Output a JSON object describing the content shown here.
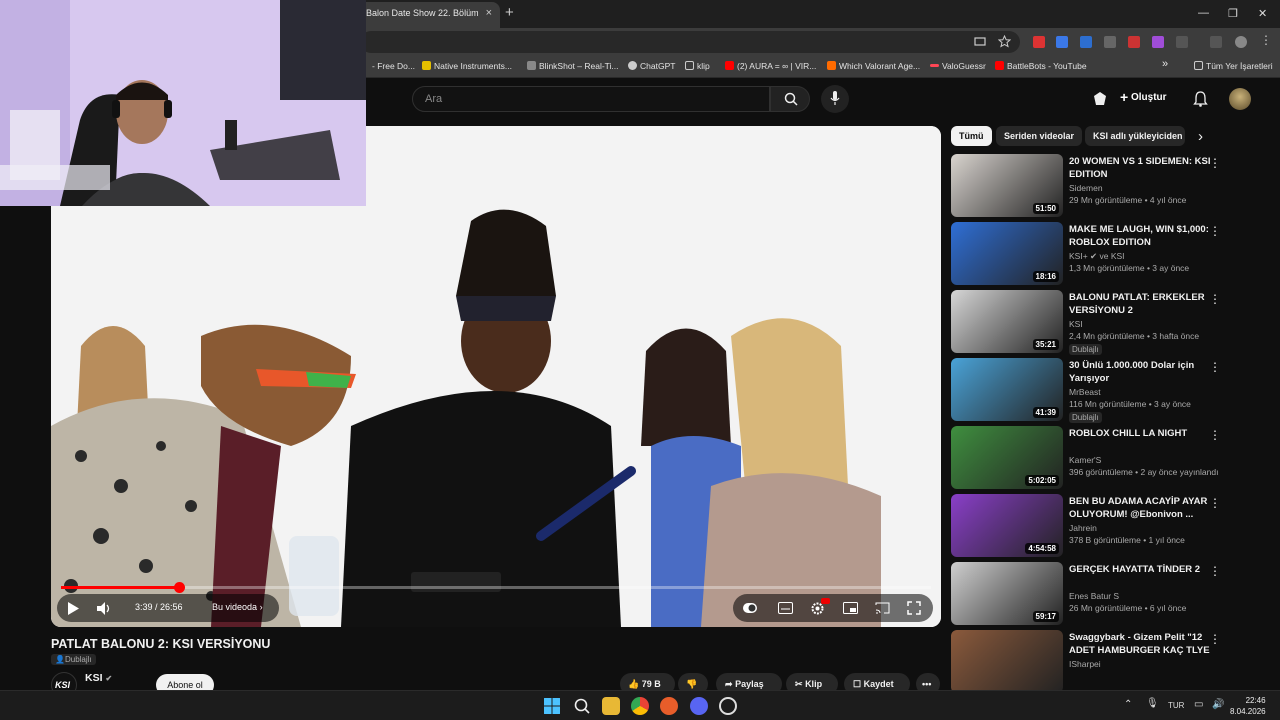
{
  "browser": {
    "active_tab_title": "Balon Date Show 22. Bölüm - Y",
    "tab_close": "×",
    "new_tab": "+",
    "window_controls": [
      "—",
      "❐",
      "✕"
    ],
    "bookmarks": [
      {
        "label": "- Free Do...",
        "color": "#3b78e7"
      },
      {
        "label": "Native Instruments...",
        "color": "#e5c000"
      },
      {
        "label": "BlinkShot – Real-Ti...",
        "color": "#888888"
      },
      {
        "label": "ChatGPT",
        "color": "#cccccc"
      },
      {
        "label": "klip",
        "color": "#cccccc"
      },
      {
        "label": "(2) AURA = ∞ | VIR...",
        "color": "#ff0000"
      },
      {
        "label": "Which Valorant Age...",
        "color": "#ff6b00"
      },
      {
        "label": "ValoGuessr",
        "color": "#ff4655"
      },
      {
        "label": "BattleBots - YouTube",
        "color": "#ff0000"
      }
    ],
    "bookmarks_more": "»",
    "all_bookmarks": "Tüm Yer İşaretleri"
  },
  "youtube": {
    "search_placeholder": "Ara",
    "create_label": "Oluştur"
  },
  "video": {
    "time": "3:39 / 26:56",
    "chapter": "Bu videoda",
    "progress": 0.136,
    "title": "PATLAT BALONU 2: KSI VERSİYONU",
    "dub_badge": "Dublajlı",
    "channel": "KSI",
    "channel_logo": "KSI",
    "subscribe": "Abone ol",
    "likes": "79 B",
    "share": "Paylaş",
    "clip": "Klip",
    "save": "Kaydet"
  },
  "sidebar": {
    "chips": [
      "Tümü",
      "Seriden videolar",
      "KSI adlı yükleyiciden"
    ],
    "chip_next": "›",
    "recommendations": [
      {
        "title": "20 WOMEN VS 1 SIDEMEN: KSI EDITION",
        "channel": "Sidemen",
        "meta": "29 Mn görüntüleme • 4 yıl önce",
        "duration": "51:50",
        "badge": "",
        "thumb": "#d9d4cf"
      },
      {
        "title": "MAKE ME LAUGH, WIN $1,000: ROBLOX EDITION",
        "channel": "KSI+ ✔ ve KSI",
        "meta": "1,3 Mn görüntüleme • 3 ay önce",
        "duration": "18:16",
        "badge": "",
        "thumb": "#2f6fd6"
      },
      {
        "title": "BALONU PATLAT: ERKEKLER VERSİYONU 2",
        "channel": "KSI",
        "meta": "2,4 Mn görüntüleme • 3 hafta önce",
        "duration": "35:21",
        "badge": "Dublajlı",
        "thumb": "#d6d6d6"
      },
      {
        "title": "30 Ünlü 1.000.000 Dolar için Yarışıyor",
        "channel": "MrBeast",
        "meta": "116 Mn görüntüleme • 3 ay önce",
        "duration": "41:39",
        "badge": "Dublajlı",
        "thumb": "#4aa3d8"
      },
      {
        "title": "ROBLOX  CHILL LA NIGHT",
        "channel": "Kamer'S",
        "meta": "396 görüntüleme • 2 ay önce yayınlandı",
        "duration": "5:02:05",
        "badge": "",
        "thumb": "#3f8f3f"
      },
      {
        "title": "BEN BU ADAMA ACAYİP AYAR OLUYORUM! @Ebonivon  ...",
        "channel": "Jahrein",
        "meta": "378 B görüntüleme • 1 yıl önce",
        "duration": "4:54:58",
        "badge": "",
        "thumb": "#8a3fc9"
      },
      {
        "title": "GERÇEK HAYATTA TİNDER 2",
        "channel": "Enes Batur S",
        "meta": "26 Mn görüntüleme • 6 yıl önce",
        "duration": "59:17",
        "badge": "",
        "thumb": "#cfcfcf"
      },
      {
        "title": "Swaggybark - Gizem Pelit \"12 ADET HAMBURGER KAÇ TLYE ...",
        "channel": "ISharpei",
        "meta": "",
        "duration": "",
        "badge": "",
        "thumb": "#8b5a3c"
      }
    ]
  },
  "taskbar": {
    "lang": "TUR",
    "time": "22:46",
    "date": "8.04.2026"
  }
}
